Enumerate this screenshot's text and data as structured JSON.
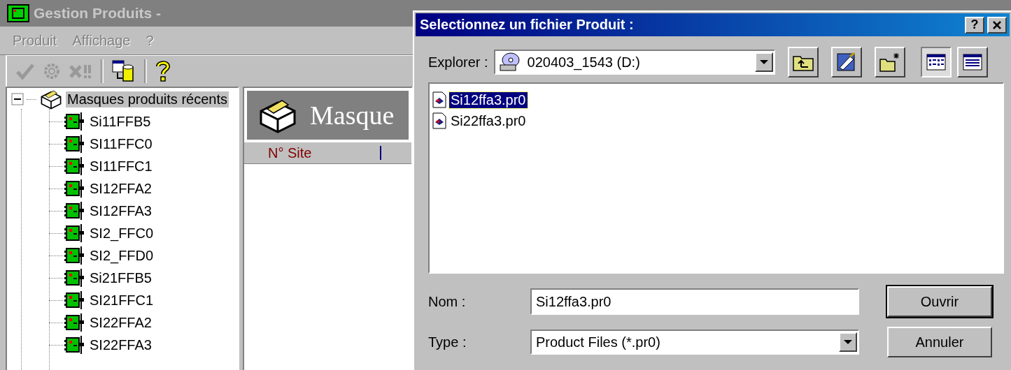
{
  "main_window": {
    "title": "Gestion Produits -",
    "menu": [
      {
        "label": "Produit",
        "disabled": true
      },
      {
        "label": "Affichage",
        "disabled": true
      },
      {
        "label": "?",
        "disabled": true
      }
    ],
    "toolbar": [
      {
        "kind": "check",
        "disabled": true
      },
      {
        "kind": "gear",
        "disabled": true
      },
      {
        "kind": "delete",
        "disabled": true
      },
      {
        "kind": "separator"
      },
      {
        "kind": "database",
        "disabled": false
      },
      {
        "kind": "separator"
      },
      {
        "kind": "help",
        "disabled": false
      }
    ],
    "tree": {
      "label": "Masques produits récents",
      "expanded": true,
      "selected": true,
      "children": [
        {
          "label": "Si11FFB5",
          "selected": false
        },
        {
          "label": "SI11FFC0",
          "selected": false
        },
        {
          "label": "SI11FFC1",
          "selected": false
        },
        {
          "label": "SI12FFA2",
          "selected": false
        },
        {
          "label": "SI12FFA3",
          "selected": false
        },
        {
          "label": "SI2_FFC0",
          "selected": false
        },
        {
          "label": "SI2_FFD0",
          "selected": false
        },
        {
          "label": "Si21FFB5",
          "selected": false
        },
        {
          "label": "SI21FFC1",
          "selected": false
        },
        {
          "label": "SI22FFA2",
          "selected": false
        },
        {
          "label": "SI22FFA3",
          "selected": false
        }
      ]
    },
    "panel": {
      "title": "Masque",
      "columns": [
        "N° Site"
      ]
    }
  },
  "dialog": {
    "title": "Selectionnez un fichier Produit :",
    "help_button": "?",
    "look_in_label": "Explorer :",
    "look_in_value": "020403_1543 (D:)",
    "toolbar": [
      {
        "kind": "up-folder",
        "selected": false
      },
      {
        "kind": "desktop",
        "selected": false
      },
      {
        "kind": "new-folder",
        "selected": false
      },
      {
        "kind": "list",
        "selected": true
      },
      {
        "kind": "details",
        "selected": false
      }
    ],
    "files": [
      {
        "name": "Si12ffa3.pr0",
        "selected": true
      },
      {
        "name": "Si22ffa3.pr0",
        "selected": false
      }
    ],
    "name_label": "Nom :",
    "name_value": "Si12ffa3.pr0",
    "type_label": "Type :",
    "type_value": "Product Files (*.pr0)",
    "buttons": [
      {
        "label": "Ouvrir",
        "default": true
      },
      {
        "label": "Annuler",
        "default": false
      }
    ]
  }
}
